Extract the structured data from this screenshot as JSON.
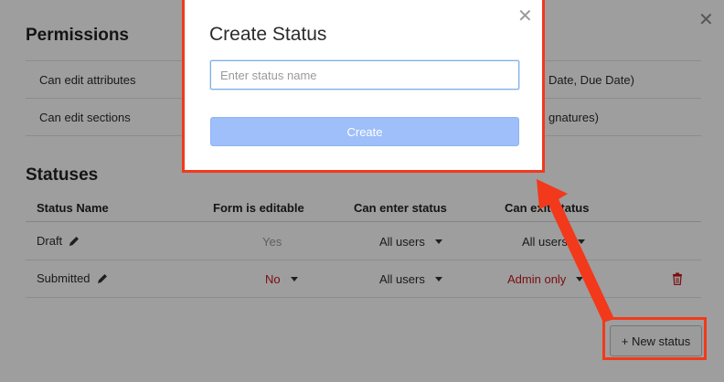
{
  "permissions": {
    "title": "Permissions",
    "rows": [
      {
        "label": "Can edit attributes",
        "value": "Date, Due Date)"
      },
      {
        "label": "Can edit sections",
        "value": "gnatures)"
      }
    ]
  },
  "statuses": {
    "title": "Statuses",
    "headers": {
      "name": "Status Name",
      "form_editable": "Form is editable",
      "can_enter": "Can enter status",
      "can_exit": "Can exit status"
    },
    "rows": [
      {
        "name": "Draft",
        "form_editable": "Yes",
        "can_enter": "All users",
        "can_exit": "All users"
      },
      {
        "name": "Submitted",
        "form_editable": "No",
        "can_enter": "All users",
        "can_exit": "Admin only"
      }
    ],
    "new_status_label": "+ New status"
  },
  "modal": {
    "title": "Create Status",
    "input_placeholder": "Enter status name",
    "input_value": "",
    "create_label": "Create"
  },
  "colors": {
    "annotation": "#f2391b",
    "danger": "#c8161d",
    "primary_disabled": "#9ebffa"
  },
  "icons": {
    "close": "close-icon",
    "edit": "pencil-icon",
    "delete": "trash-icon",
    "dropdown": "caret-down-icon"
  }
}
